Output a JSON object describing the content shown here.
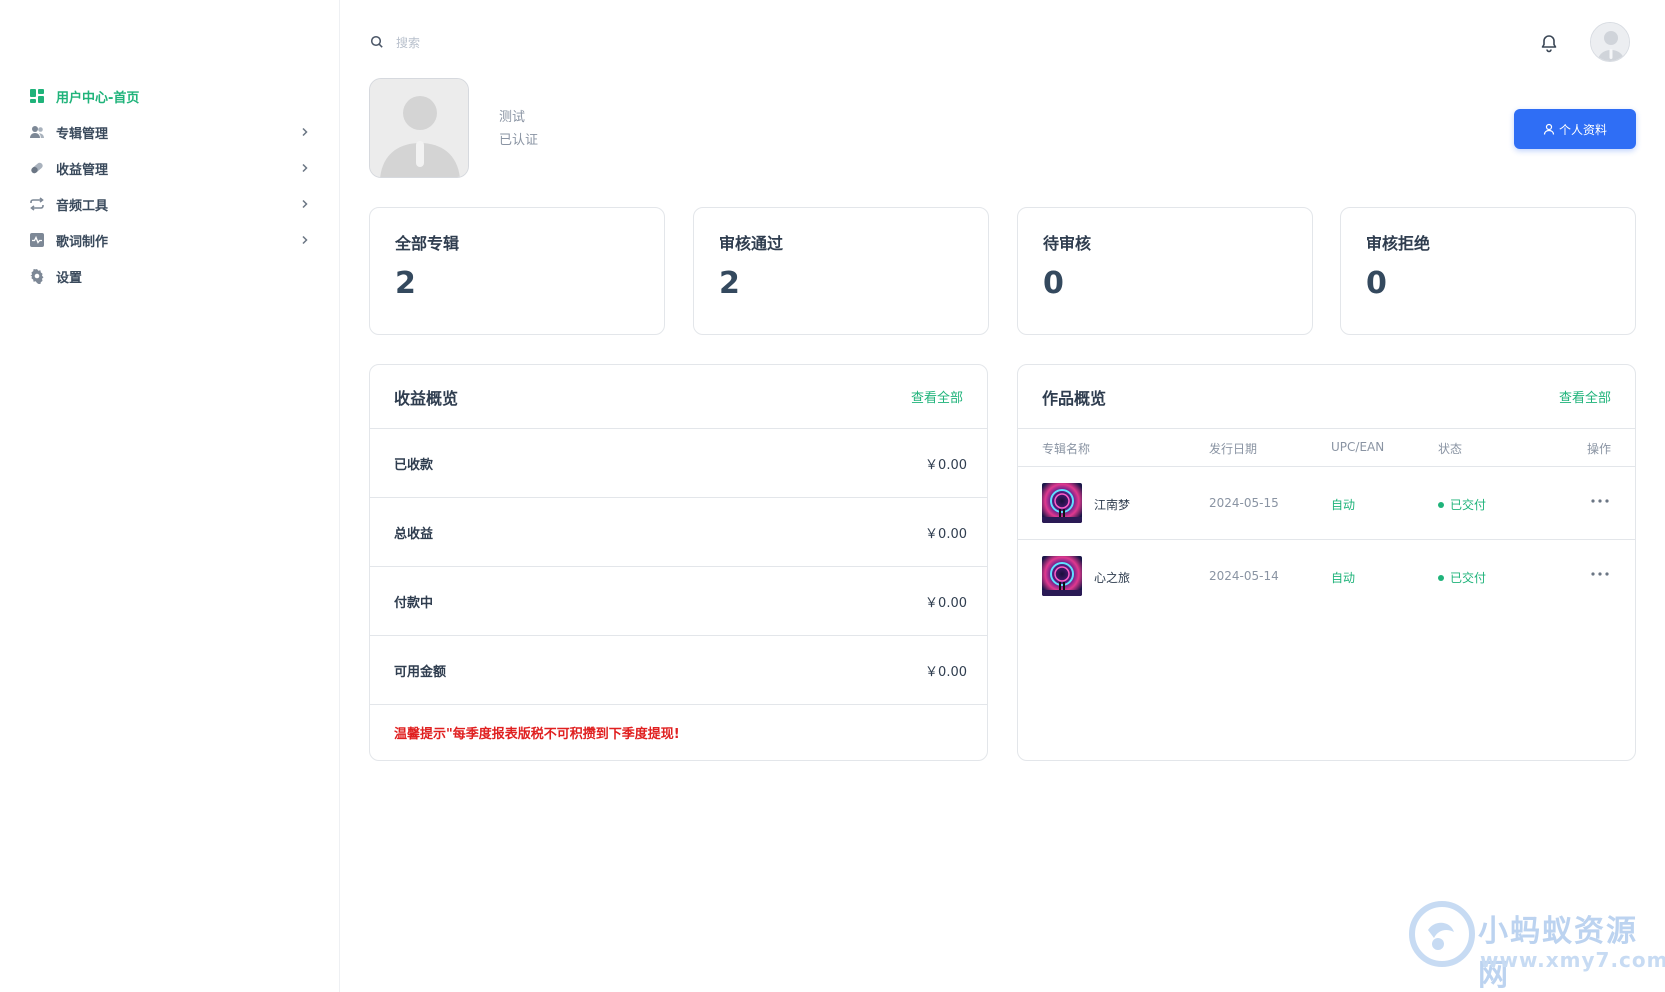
{
  "sidebar": {
    "items": [
      {
        "label": "用户中心-首页",
        "icon": "dashboard-icon"
      },
      {
        "label": "专辑管理",
        "icon": "users-icon"
      },
      {
        "label": "收益管理",
        "icon": "pill-icon"
      },
      {
        "label": "音频工具",
        "icon": "repeat-icon"
      },
      {
        "label": "歌词制作",
        "icon": "activity-icon"
      },
      {
        "label": "设置",
        "icon": "gear-icon"
      }
    ]
  },
  "topbar": {
    "search_placeholder": "搜索"
  },
  "profile": {
    "name": "测试",
    "status": "已认证",
    "button_label": "个人资料"
  },
  "stats": [
    {
      "title": "全部专辑",
      "value": "2"
    },
    {
      "title": "审核通过",
      "value": "2"
    },
    {
      "title": "待审核",
      "value": "0"
    },
    {
      "title": "审核拒绝",
      "value": "0"
    }
  ],
  "income": {
    "title": "收益概览",
    "link": "查看全部",
    "rows": [
      {
        "label": "已收款",
        "value": "￥0.00"
      },
      {
        "label": "总收益",
        "value": "￥0.00"
      },
      {
        "label": "付款中",
        "value": "￥0.00"
      },
      {
        "label": "可用金额",
        "value": "￥0.00"
      }
    ],
    "notice": "温馨提示\"每季度报表版税不可积攒到下季度提现!"
  },
  "works": {
    "title": "作品概览",
    "link": "查看全部",
    "columns": [
      "专辑名称",
      "发行日期",
      "UPC/EAN",
      "状态",
      "操作"
    ],
    "rows": [
      {
        "name": "江南梦",
        "date": "2024-05-15",
        "upc": "自动",
        "status": "已交付"
      },
      {
        "name": "心之旅",
        "date": "2024-05-14",
        "upc": "自动",
        "status": "已交付"
      }
    ]
  },
  "watermark": {
    "line1": "小蚂蚁资源网",
    "line2": "www.xmy7.com"
  },
  "colors": {
    "accent_green": "#1fb37a",
    "primary_blue": "#2f6ef5",
    "notice_red": "#e02020",
    "border": "#e3e6ea"
  }
}
